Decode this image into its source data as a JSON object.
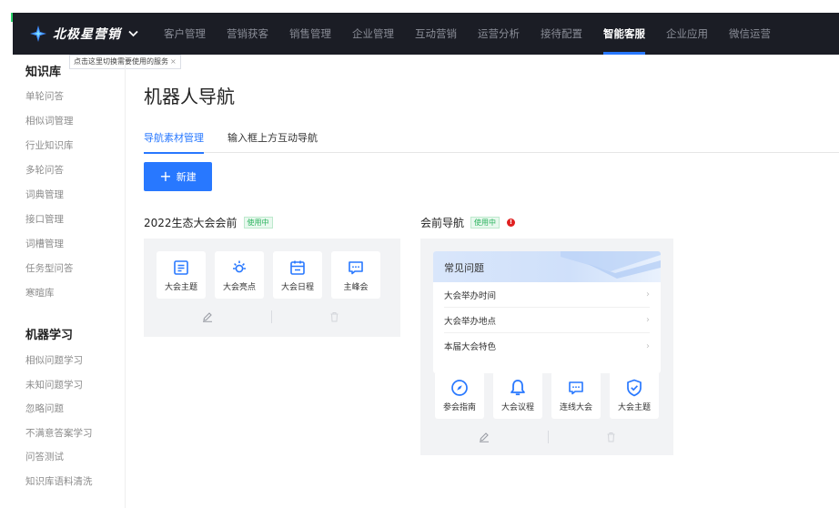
{
  "brand": {
    "name": "北极星营销"
  },
  "nav": [
    "客户管理",
    "营销获客",
    "销售管理",
    "企业管理",
    "互动营销",
    "运营分析",
    "接待配置",
    "智能客服",
    "企业应用",
    "微信运营"
  ],
  "nav_active": "智能客服",
  "tooltip": {
    "text": "点击这里切换需要使用的服务",
    "close": "×"
  },
  "sidebar": {
    "group1": "知识库",
    "group1_items": [
      "单轮问答",
      "相似词管理",
      "行业知识库",
      "多轮问答",
      "词典管理",
      "接口管理",
      "词槽管理",
      "任务型问答",
      "寒暄库"
    ],
    "group2": "机器学习",
    "group2_items": [
      "相似问题学习",
      "未知问题学习",
      "忽略问题",
      "不满意答案学习",
      "问答测试",
      "知识库语料清洗"
    ]
  },
  "page": {
    "title": "机器人导航"
  },
  "tabs": [
    "导航素材管理",
    "输入框上方互动导航"
  ],
  "new_button": {
    "label": "新建",
    "icon": "plus-icon"
  },
  "card1": {
    "title": "2022生态大会会前",
    "badge": "使用中",
    "tiles": [
      {
        "label": "大会主题",
        "icon": "document-icon"
      },
      {
        "label": "大会亮点",
        "icon": "sun-icon"
      },
      {
        "label": "大会日程",
        "icon": "calendar-icon"
      },
      {
        "label": "主峰会",
        "icon": "chat-icon"
      }
    ]
  },
  "card2": {
    "title": "会前导航",
    "badge": "使用中",
    "warning": "!",
    "faq_title": "常见问题",
    "faq_items": [
      "大会举办时间",
      "大会举办地点",
      "本届大会特色"
    ],
    "tiles": [
      {
        "label": "参会指南",
        "icon": "compass-icon"
      },
      {
        "label": "大会议程",
        "icon": "bell-icon"
      },
      {
        "label": "连线大会",
        "icon": "chat-icon"
      },
      {
        "label": "大会主题",
        "icon": "shield-check-icon"
      }
    ]
  },
  "colors": {
    "accent": "#2878ff",
    "topbar": "#1b1d25",
    "success": "#2bb35e",
    "danger": "#e02020"
  }
}
